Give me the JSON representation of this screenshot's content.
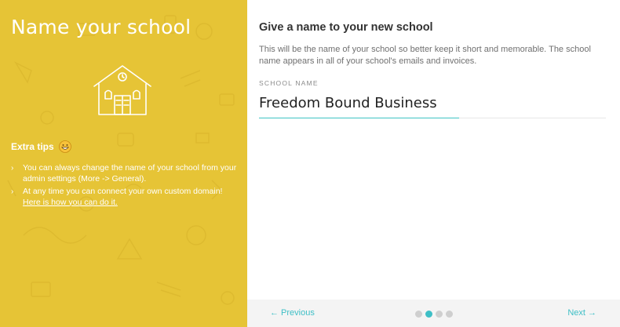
{
  "left_panel": {
    "title": "Name your school",
    "tips_heading": "Extra tips",
    "tips": [
      {
        "text": "You can always change the name of your school from your admin settings (More -> General)."
      },
      {
        "text": "At any time you can connect your own custom domain!",
        "link": "Here is how you can do it."
      }
    ],
    "bg_color": "#e6c436"
  },
  "main": {
    "title": "Give a name to your new school",
    "description": "This will be the name of your school so better keep it short and memorable. The school name appears in all of your school's emails and invoices.",
    "field_label": "SCHOOL NAME",
    "school_name_value": "Freedom Bound Business"
  },
  "footer": {
    "previous_label": "← Previous",
    "next_label": "Next →",
    "steps": 4,
    "current_step": 2,
    "accent_color": "#3ebfc6"
  }
}
